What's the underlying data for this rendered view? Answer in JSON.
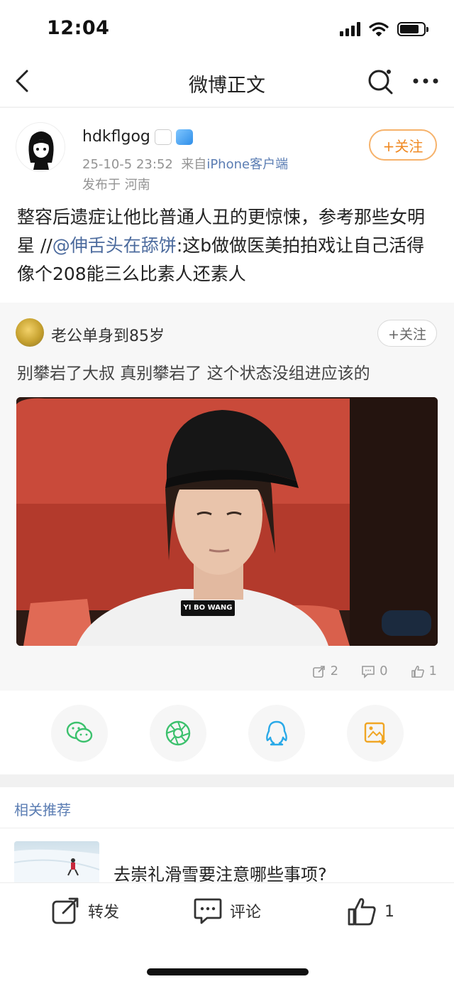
{
  "status_bar": {
    "time": "12:04"
  },
  "nav": {
    "title": "微博正文"
  },
  "post": {
    "username": "hdkflgog",
    "timestamp": "25-10-5 23:52",
    "source_prefix": "来自",
    "source": "iPhone客户端",
    "location": "发布于 河南",
    "follow_label": "+关注",
    "text_before": "整容后遗症让他比普通人丑的更惊悚，参考那些女明星 //",
    "mention": "@伸舌头在舔饼",
    "text_after": ":这b做做医美拍拍戏让自己活得像个208能三么比素人还素人"
  },
  "repost": {
    "username": "老公单身到85岁",
    "follow_label": "+关注",
    "text": "别攀岩了大叔 真别攀岩了 这个状态没组进应该的",
    "photo_caption": "YI BO WANG",
    "stats": {
      "reposts": "2",
      "comments": "0",
      "likes": "1"
    }
  },
  "share": {
    "items": [
      "wechat-icon",
      "moments-icon",
      "qq-icon",
      "save-image-icon"
    ],
    "colors": {
      "wechat": "#3cc16d",
      "moments": "#3cc16d",
      "qq": "#29a9e8",
      "save": "#f0a625"
    }
  },
  "recommend": {
    "title": "相关推荐",
    "item_title": "去崇礼滑雪要注意哪些事项?"
  },
  "bottom_bar": {
    "repost_label": "转发",
    "comment_label": "评论",
    "like_count": "1"
  }
}
